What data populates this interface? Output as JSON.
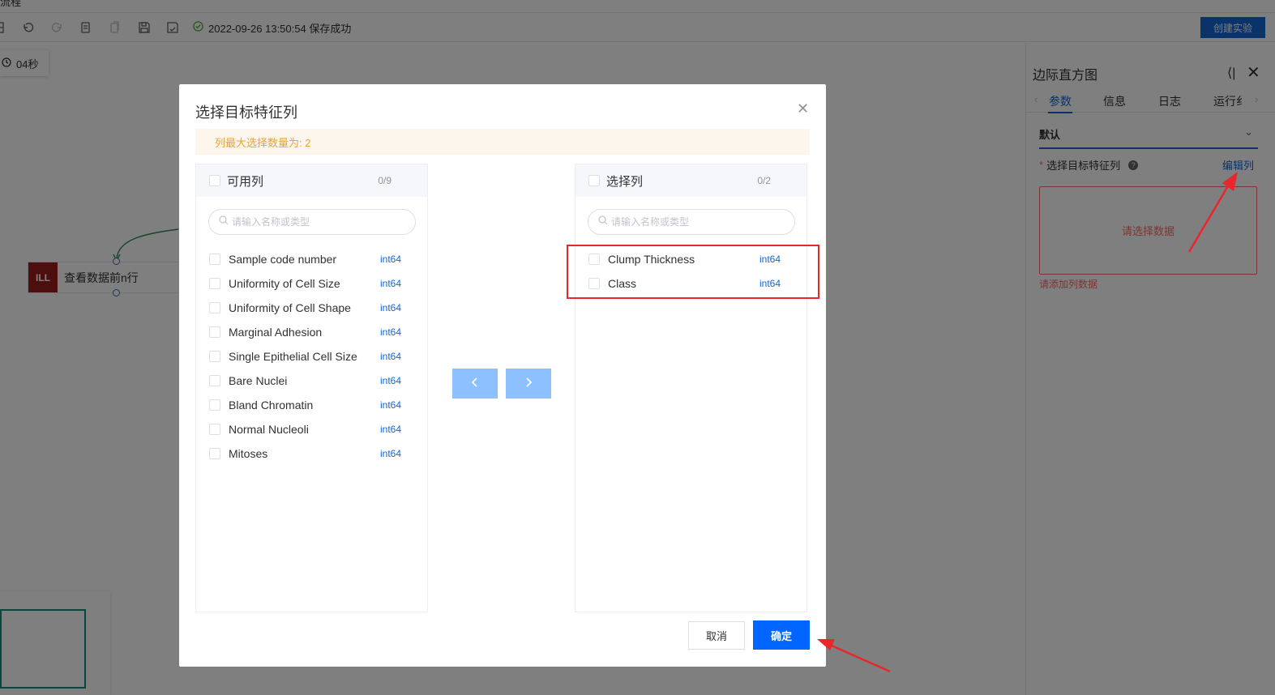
{
  "app": {
    "top_cut_text": "流程"
  },
  "toolbar": {
    "icons": [
      "pipeline-icon",
      "undo-icon",
      "redo-icon",
      "copy-icon",
      "paste-icon",
      "save-icon",
      "save-as-icon"
    ],
    "save_status": "2022-09-26 13:50:54 保存成功",
    "create_label": "创建实验"
  },
  "canvas": {
    "timer": "04秒",
    "node_label": "查看数据前n行",
    "node_icon_text": "ILL"
  },
  "right_panel": {
    "title": "边际直方图",
    "tabs": [
      "参数",
      "信息",
      "日志",
      "运行纟"
    ],
    "active_tab": 0,
    "section": "默认",
    "field_required_mark": "*",
    "field_label": "选择目标特征列",
    "help_mark": "?",
    "edit_link": "编辑列",
    "empty_text": "请选择数据",
    "error_text": "请添加列数据"
  },
  "dialog": {
    "title": "选择目标特征列",
    "alert": "列最大选择数量为: 2",
    "left": {
      "title": "可用列",
      "count": "0/9",
      "search_placeholder": "请输入名称或类型",
      "items": [
        {
          "name": "Sample code number",
          "type": "int64"
        },
        {
          "name": "Uniformity of Cell Size",
          "type": "int64"
        },
        {
          "name": "Uniformity of Cell Shape",
          "type": "int64"
        },
        {
          "name": "Marginal Adhesion",
          "type": "int64"
        },
        {
          "name": "Single Epithelial Cell Size",
          "type": "int64"
        },
        {
          "name": "Bare Nuclei",
          "type": "int64"
        },
        {
          "name": "Bland Chromatin",
          "type": "int64"
        },
        {
          "name": "Normal Nucleoli",
          "type": "int64"
        },
        {
          "name": "Mitoses",
          "type": "int64"
        }
      ]
    },
    "right": {
      "title": "选择列",
      "count": "0/2",
      "search_placeholder": "请输入名称或类型",
      "items": [
        {
          "name": "Clump Thickness",
          "type": "int64"
        },
        {
          "name": "Class",
          "type": "int64"
        }
      ]
    },
    "cancel_label": "取消",
    "ok_label": "确定"
  },
  "colors": {
    "primary": "#1366d2",
    "ok_button": "#0066ff",
    "transfer_button": "#8cc0ff",
    "alert_bg": "#fdf6ec",
    "alert_text": "#e6a23c",
    "error": "#f56c6c",
    "annotation": "#e8262c"
  }
}
